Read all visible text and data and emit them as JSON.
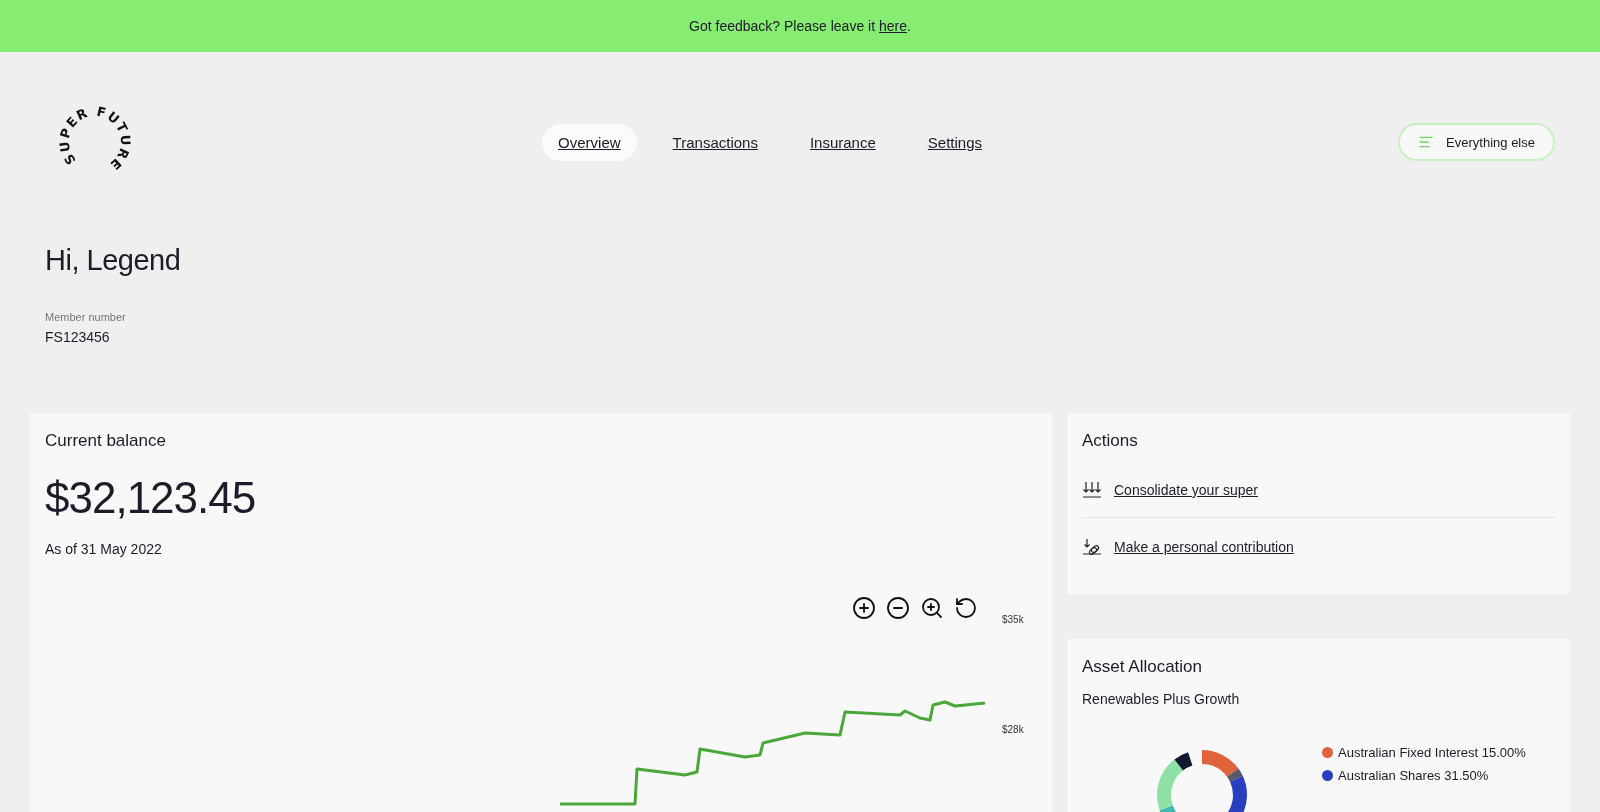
{
  "banner": {
    "text": "Got feedback? Please leave it",
    "link": "here",
    "suffix": "."
  },
  "logo": {
    "text": "SUPER FUTURE"
  },
  "nav": [
    {
      "label": "Overview",
      "selected": true
    },
    {
      "label": "Transactions",
      "selected": false
    },
    {
      "label": "Insurance",
      "selected": false
    },
    {
      "label": "Settings",
      "selected": false
    }
  ],
  "menu_button": {
    "label": "Everything else"
  },
  "greeting": "Hi, Legend",
  "member": {
    "label": "Member number",
    "value": "FS123456"
  },
  "balance": {
    "title": "Current balance",
    "amount": "$32,123.45",
    "as_of": "As of 31 May 2022",
    "chart": {
      "y_labels": [
        "$35k",
        "$28k"
      ]
    }
  },
  "actions": {
    "title": "Actions",
    "items": [
      {
        "label": "Consolidate your super",
        "kind": "consolidate"
      },
      {
        "label": "Make a personal contribution",
        "kind": "contribute"
      }
    ]
  },
  "asset_allocation": {
    "title": "Asset Allocation",
    "subtitle": "Renewables Plus Growth",
    "legend": [
      {
        "label": "Australian Fixed Interest 15.00%",
        "color": "#e0623a"
      },
      {
        "label": "Australian Shares 31.50%",
        "color": "#2a3fc0"
      }
    ]
  }
}
